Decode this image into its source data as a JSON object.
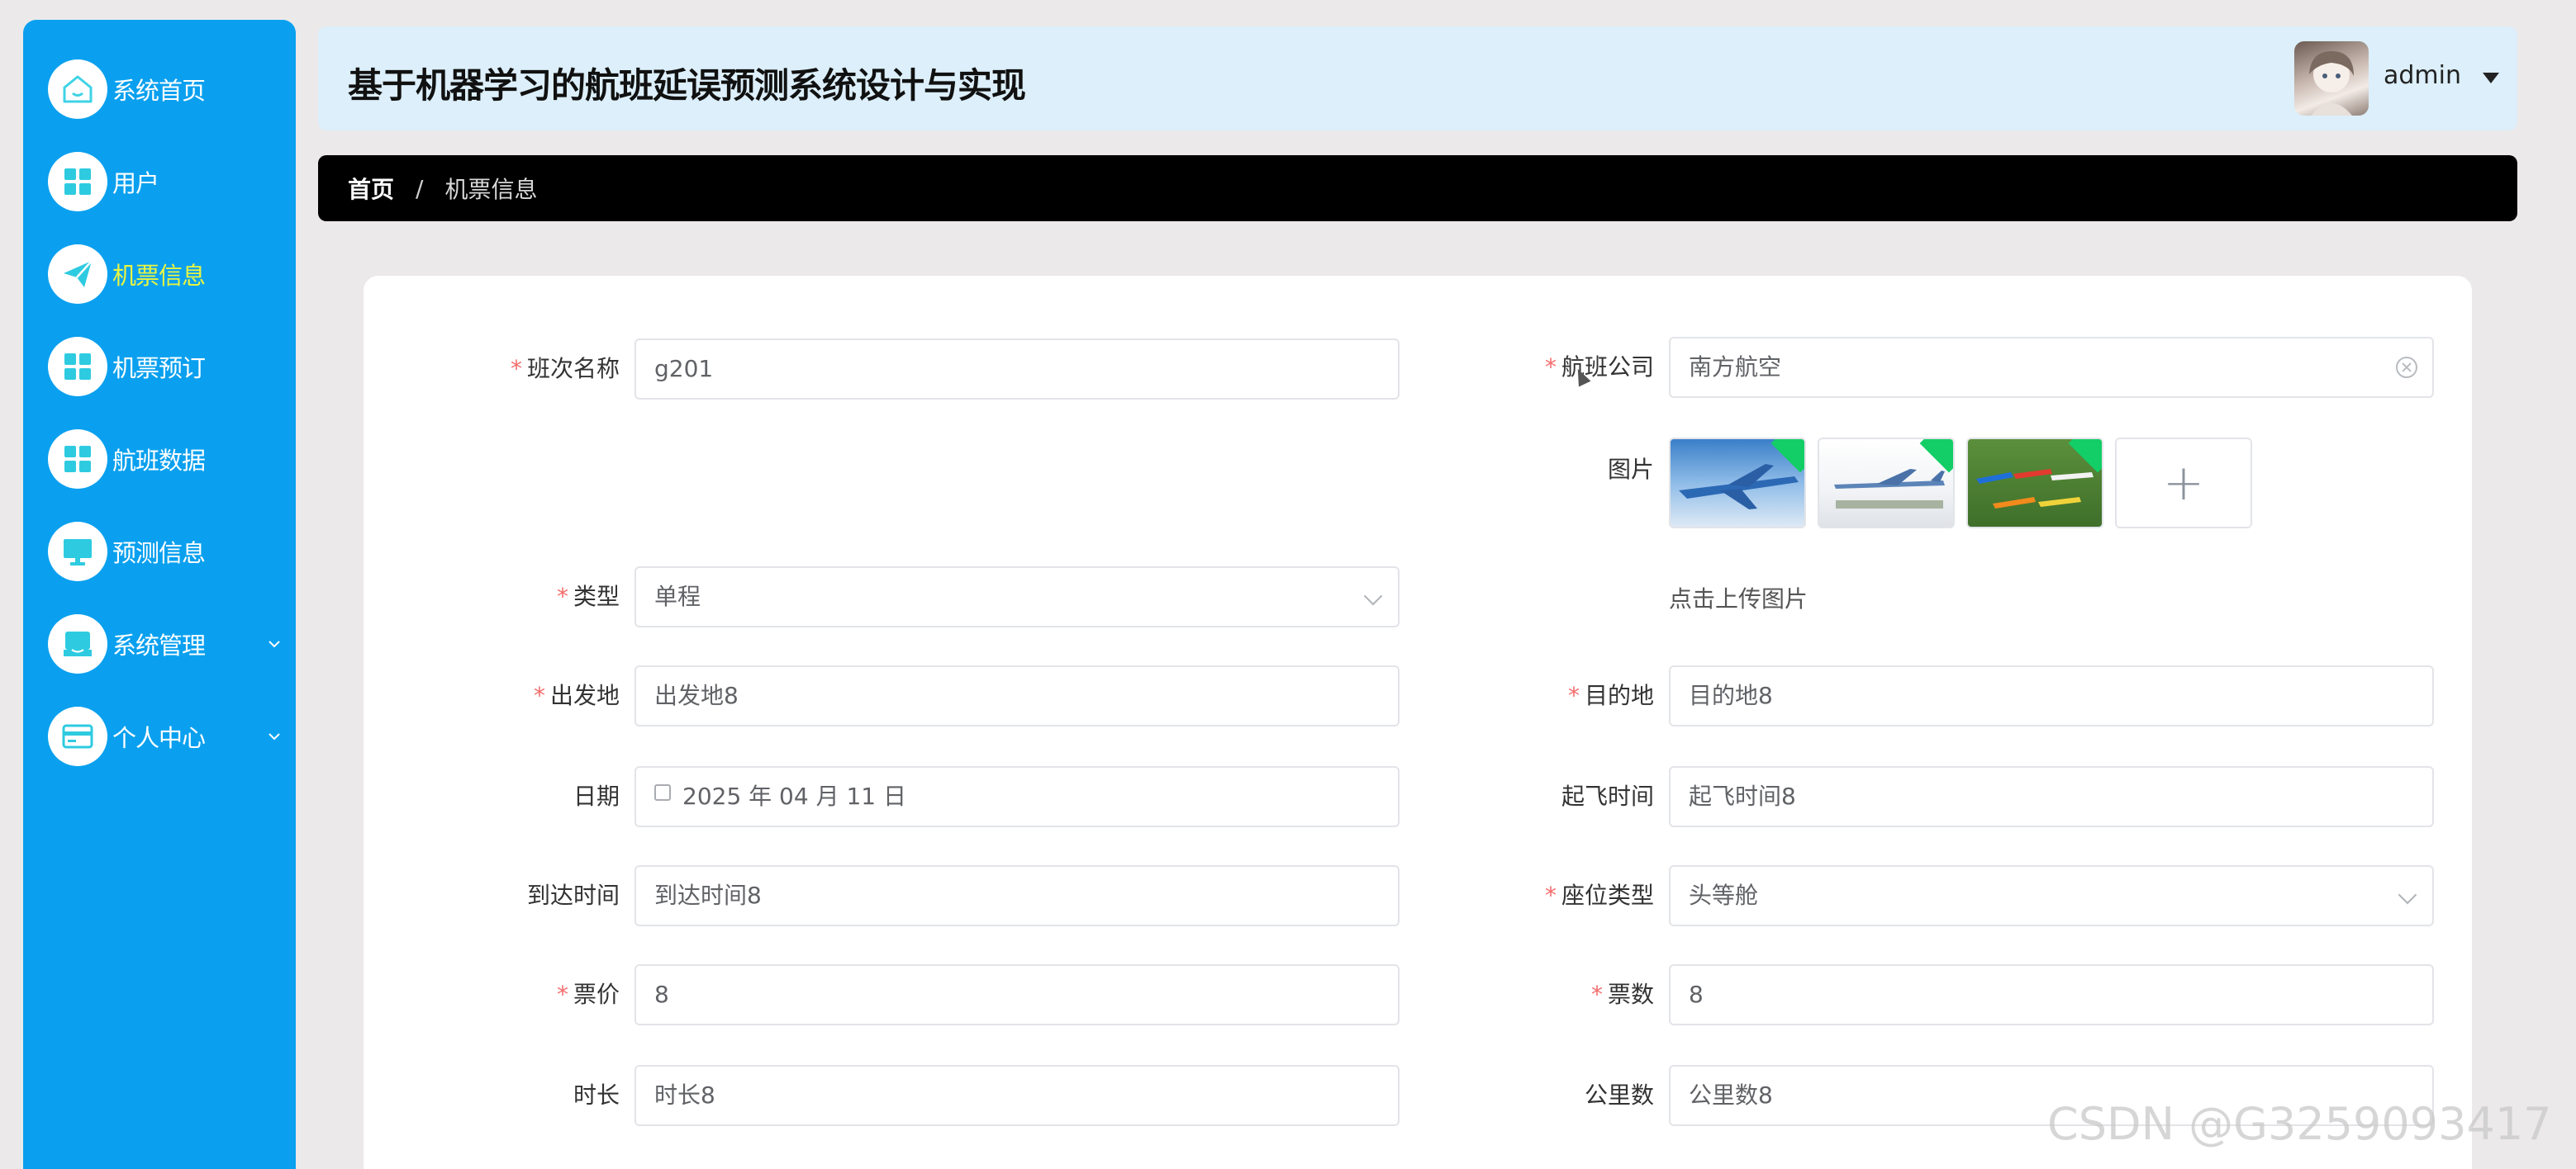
{
  "app": {
    "title": "基于机器学习的航班延误预测系统设计与实现"
  },
  "user": {
    "name": "admin"
  },
  "sidebar": {
    "items": [
      {
        "label": "系统首页",
        "icon": "home-icon"
      },
      {
        "label": "用户",
        "icon": "grid-icon"
      },
      {
        "label": "机票信息",
        "icon": "paper-plane-icon",
        "active": true
      },
      {
        "label": "机票预订",
        "icon": "grid-icon"
      },
      {
        "label": "航班数据",
        "icon": "grid-icon"
      },
      {
        "label": "预测信息",
        "icon": "monitor-icon"
      },
      {
        "label": "系统管理",
        "icon": "inbox-icon",
        "expandable": true
      },
      {
        "label": "个人中心",
        "icon": "card-icon",
        "expandable": true
      }
    ]
  },
  "breadcrumb": {
    "home": "首页",
    "separator": "/",
    "current": "机票信息"
  },
  "form": {
    "flight_name": {
      "label": "班次名称",
      "value": "g201",
      "required": true
    },
    "airline": {
      "label": "航班公司",
      "value": "南方航空",
      "required": true
    },
    "image": {
      "label": "图片",
      "upload_tip": "点击上传图片",
      "plus": "+"
    },
    "type": {
      "label": "类型",
      "value": "单程",
      "required": true
    },
    "departure": {
      "label": "出发地",
      "value": "出发地8",
      "required": true
    },
    "destination": {
      "label": "目的地",
      "value": "目的地8",
      "required": true
    },
    "date": {
      "label": "日期",
      "value": "2025 年 04 月 11 日"
    },
    "takeoff_time": {
      "label": "起飞时间",
      "value": "起飞时间8"
    },
    "arrival_time": {
      "label": "到达时间",
      "value": "到达时间8"
    },
    "seat_type": {
      "label": "座位类型",
      "value": "头等舱",
      "required": true
    },
    "price": {
      "label": "票价",
      "value": "8",
      "required": true
    },
    "tickets": {
      "label": "票数",
      "value": "8",
      "required": true
    },
    "duration": {
      "label": "时长",
      "value": "时长8"
    },
    "mileage": {
      "label": "公里数",
      "value": "公里数8"
    }
  },
  "required_mark": "*",
  "watermark": "CSDN @G3259093417",
  "colors": {
    "sidebar": "#0aa0ef",
    "active_text": "#e9f542",
    "header": "#dceffa",
    "breadcrumb": "#000000",
    "required": "#f56c6c",
    "upload_success": "#13ce66"
  }
}
